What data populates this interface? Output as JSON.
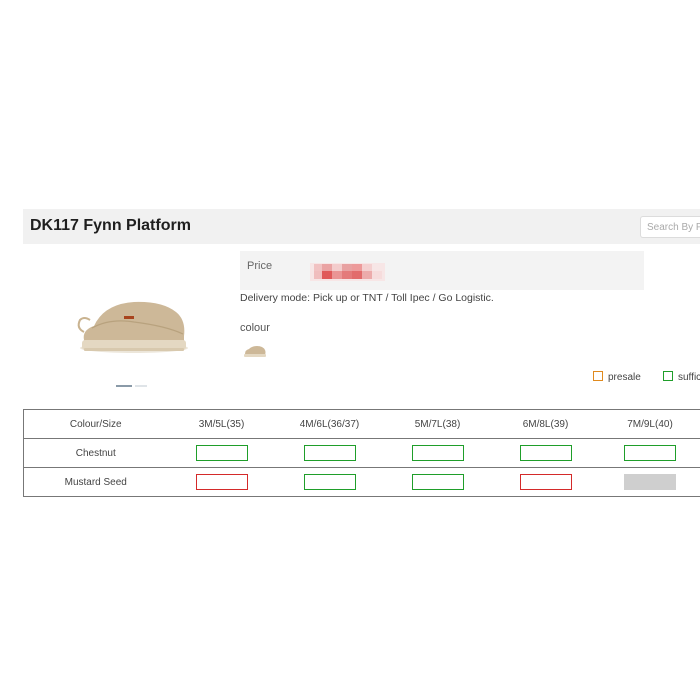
{
  "product": {
    "title": "DK117 Fynn Platform"
  },
  "search": {
    "placeholder": "Search By P"
  },
  "price": {
    "label": "Price"
  },
  "delivery": {
    "text": "Delivery mode: Pick up or TNT / Toll Ipec / Go Logistic."
  },
  "colour": {
    "label": "colour"
  },
  "legend": {
    "presale": "presale",
    "sufficient": "suffic"
  },
  "colors": {
    "presale": "#e08a1e",
    "sufficient": "#1f9e2a",
    "out_of_stock": "#d42a2a",
    "unavailable": "#cfcfcf"
  },
  "table": {
    "header_label": "Colour/Size",
    "sizes": [
      "3M/5L(35)",
      "4M/6L(36/37)",
      "5M/7L(38)",
      "6M/8L(39)",
      "7M/9L(40)"
    ],
    "rows": [
      {
        "name": "Chestnut",
        "status": [
          "sufficient",
          "sufficient",
          "sufficient",
          "sufficient",
          "sufficient"
        ]
      },
      {
        "name": "Mustard Seed",
        "status": [
          "out",
          "sufficient",
          "sufficient",
          "out",
          "na"
        ]
      }
    ]
  }
}
